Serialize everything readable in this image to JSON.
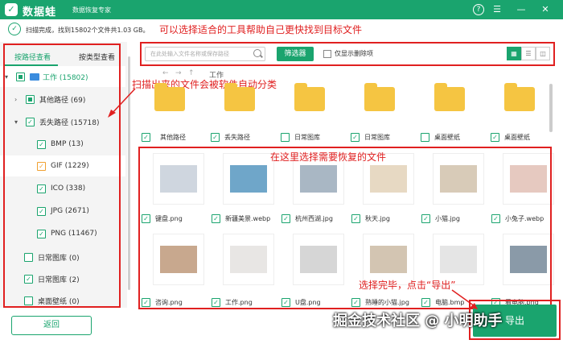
{
  "app": {
    "name": "数据蛙",
    "subtitle": "数据恢复专家"
  },
  "status": {
    "text": "扫描完成，找到15802个文件共1.03 GB。"
  },
  "annotations": {
    "top": "可以选择适合的工具帮助自己更快找到目标文件",
    "left": "扫描出来的文件会被软件自动分类",
    "center": "在这里选择需要恢复的文件",
    "bottom": "选择完毕，点击“导出”"
  },
  "sidebar": {
    "tabs": [
      "按路径查看",
      "按类型查看"
    ],
    "items": [
      {
        "label": "工作 (15802)"
      },
      {
        "label": "其他路径 (69)"
      },
      {
        "label": "丢失路径 (15718)"
      },
      {
        "label": "BMP (13)"
      },
      {
        "label": "GIF (1229)"
      },
      {
        "label": "ICO (338)"
      },
      {
        "label": "JPG (2671)"
      },
      {
        "label": "PNG (11467)"
      },
      {
        "label": "日常图库 (0)"
      },
      {
        "label": "日常图库 (2)"
      },
      {
        "label": "桌面壁纸 (0)"
      }
    ],
    "back_label": "返回"
  },
  "toolbar": {
    "search_placeholder": "在此处输入文件名称或保存路径",
    "filter_label": "筛选器",
    "deleted_only_label": "仅显示删除项"
  },
  "breadcrumb": "工作",
  "folders": [
    {
      "label": "其他路径"
    },
    {
      "label": "丢失路径"
    },
    {
      "label": "日常图库"
    },
    {
      "label": "日常图库"
    },
    {
      "label": "桌面壁纸"
    },
    {
      "label": "桌面壁纸"
    }
  ],
  "files": [
    {
      "label": "键盘.png",
      "color": "#cfd6df"
    },
    {
      "label": "新疆美景.webp",
      "color": "#6fa6c9"
    },
    {
      "label": "杭州西湖.jpg",
      "color": "#a9b7c4"
    },
    {
      "label": "秋天.jpg",
      "color": "#e7d9c3"
    },
    {
      "label": "小猫.jpg",
      "color": "#d8cbb8"
    },
    {
      "label": "小兔子.webp",
      "color": "#e6c9c0"
    },
    {
      "label": "咨询.png",
      "color": "#c8a88e"
    },
    {
      "label": "工作.png",
      "color": "#e8e6e4"
    },
    {
      "label": "U盘.png",
      "color": "#d6d6d6"
    },
    {
      "label": "熟睡的小猫.jpg",
      "color": "#d3c5b2"
    },
    {
      "label": "电脑.bmp",
      "color": "#e5e5e5"
    },
    {
      "label": "看电脑.png",
      "color": "#8a9aa8"
    }
  ],
  "recover_label": "导出",
  "watermark": "掘金技术社区 @ 小明助手"
}
